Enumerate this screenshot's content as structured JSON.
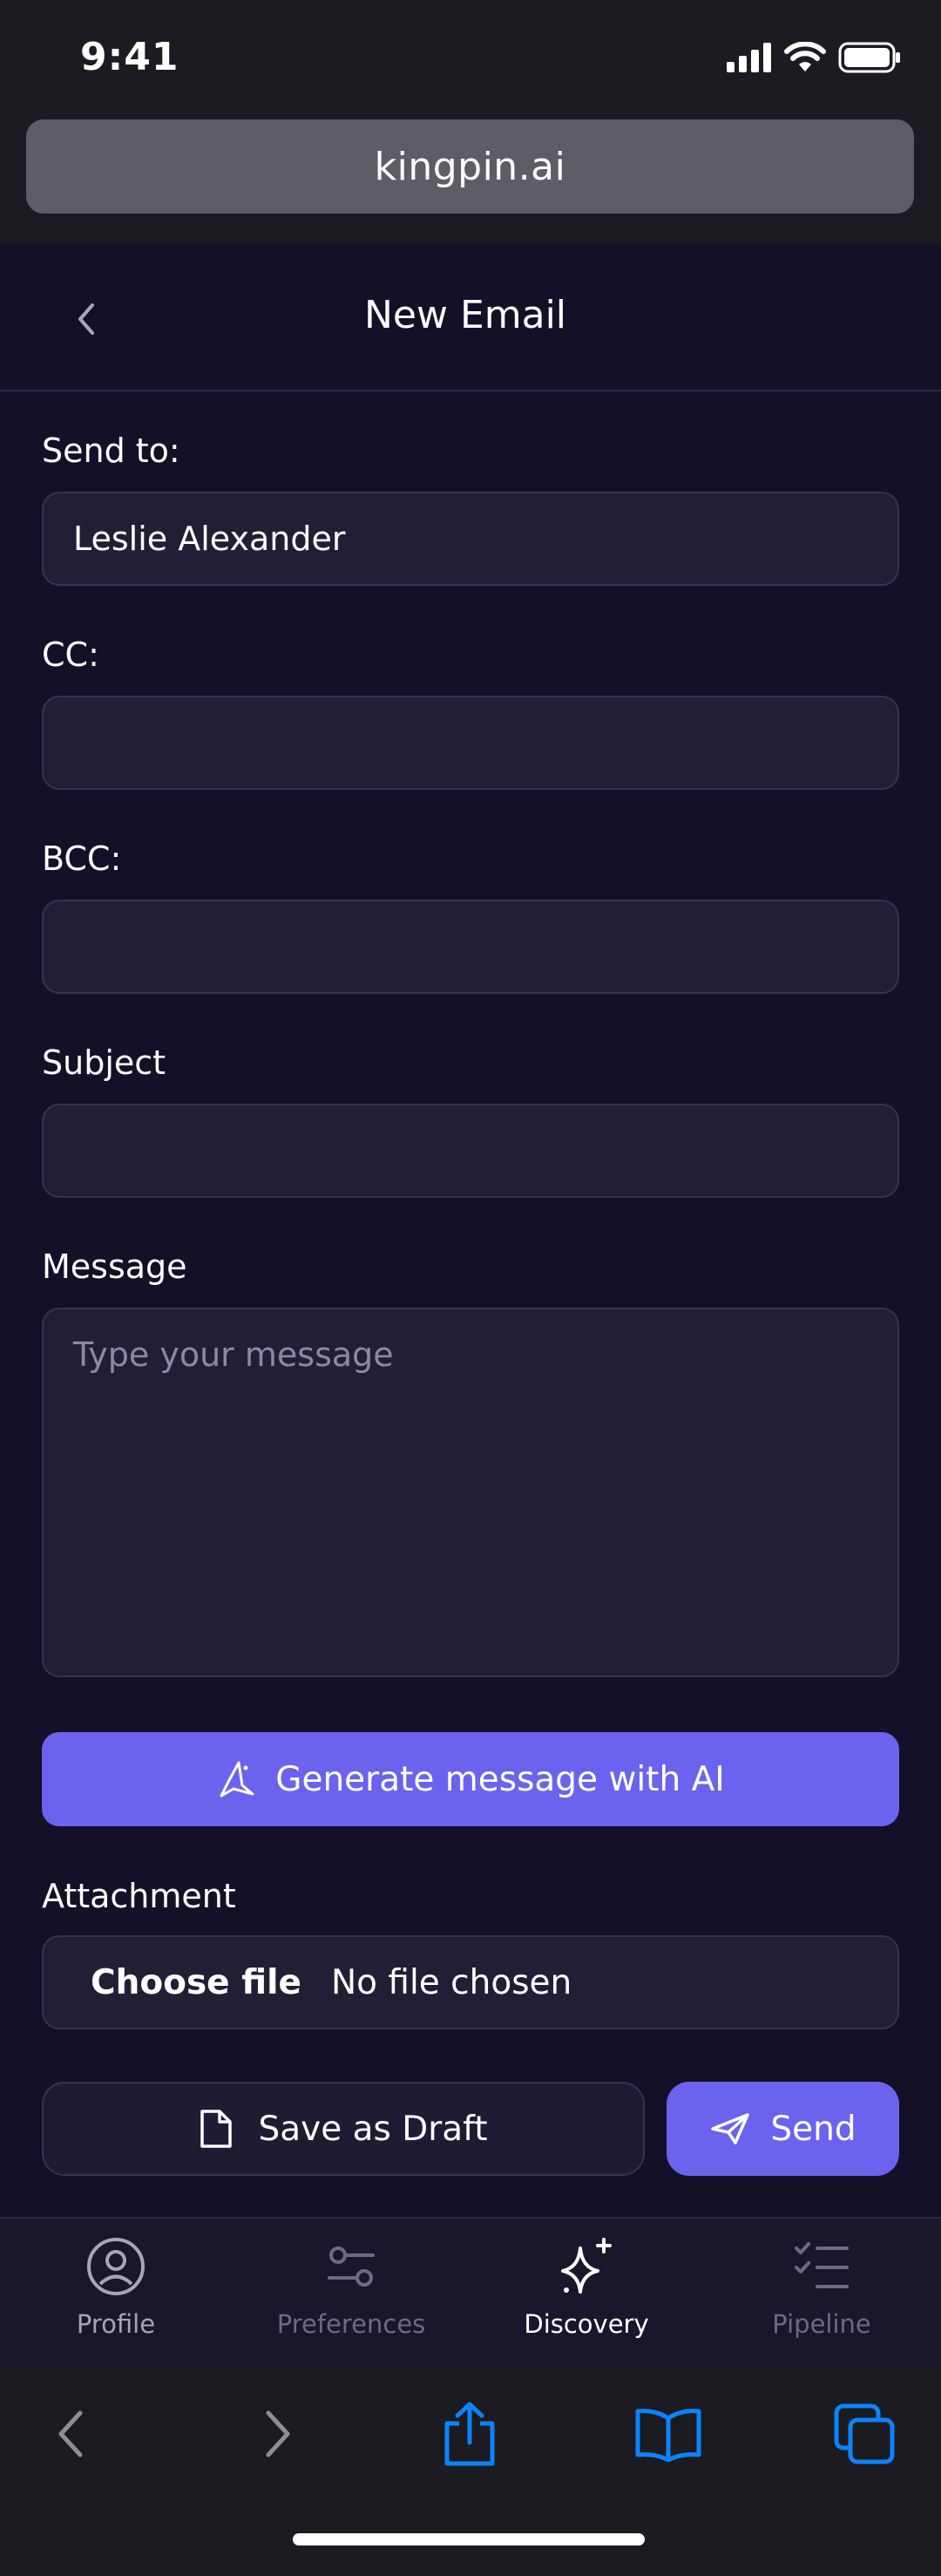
{
  "status_bar": {
    "time": "9:41"
  },
  "browser": {
    "url": "kingpin.ai"
  },
  "header": {
    "title": "New Email"
  },
  "form": {
    "send_to": {
      "label": "Send to:",
      "value": "Leslie Alexander"
    },
    "cc": {
      "label": "CC:",
      "value": ""
    },
    "bcc": {
      "label": "BCC:",
      "value": ""
    },
    "subject": {
      "label": "Subject",
      "value": ""
    },
    "message": {
      "label": "Message",
      "placeholder": "Type your message"
    },
    "ai_button": "Generate message with AI",
    "attachment": {
      "label": "Attachment",
      "button": "Choose file",
      "status": "No file chosen"
    },
    "save_draft": "Save as Draft",
    "send": "Send"
  },
  "tabs": [
    {
      "label": "Profile",
      "icon": "profile-icon"
    },
    {
      "label": "Preferences",
      "icon": "sliders-icon"
    },
    {
      "label": "Discovery",
      "icon": "sparkle-icon",
      "active": true
    },
    {
      "label": "Pipeline",
      "icon": "checklist-icon"
    }
  ],
  "colors": {
    "accent": "#6b63ee",
    "background": "#141027",
    "field": "#221e36",
    "browser_blue": "#0a84ff"
  }
}
